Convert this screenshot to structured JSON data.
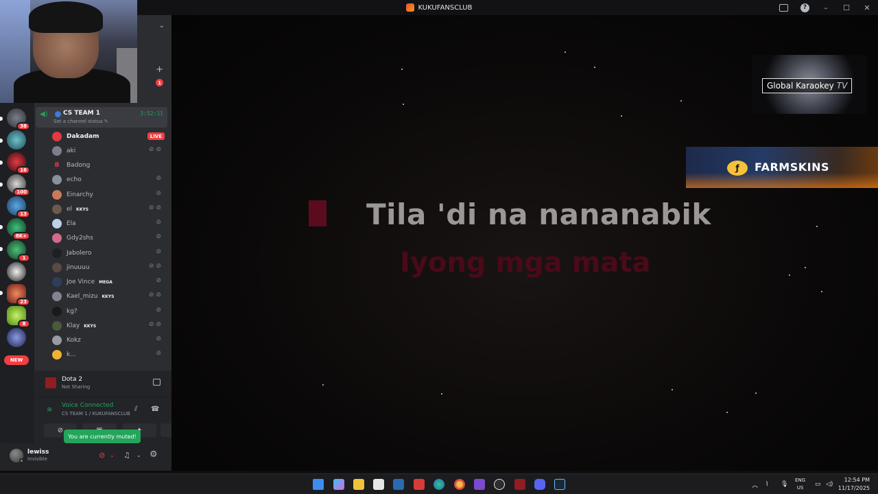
{
  "window": {
    "title": "KUKUFANSCLUB"
  },
  "servers": [
    {
      "badge": "38"
    },
    {
      "badge": ""
    },
    {
      "badge": "16"
    },
    {
      "badge": "100"
    },
    {
      "badge": "13"
    },
    {
      "badge": "8K+"
    },
    {
      "badge": "1"
    },
    {
      "badge": ""
    },
    {
      "badge": "23"
    },
    {
      "badge": "8"
    },
    {
      "badge": ""
    }
  ],
  "new_badge": "NEW",
  "mention_count": "1",
  "voice_channel": {
    "name": "CS TEAM 1",
    "timer": "3:52:11",
    "status_prompt": "Set a channel status"
  },
  "members": [
    {
      "name": "Dakadam",
      "live": "LIVE"
    },
    {
      "name": "aki"
    },
    {
      "name": "Badong"
    },
    {
      "name": "echo"
    },
    {
      "name": "Einarchy"
    },
    {
      "name": "el",
      "tag": "KKYS"
    },
    {
      "name": "Ela"
    },
    {
      "name": "Gdy2shs"
    },
    {
      "name": "Jabolero"
    },
    {
      "name": "jinuuuu"
    },
    {
      "name": "Joe Vince",
      "tag": "MEGA"
    },
    {
      "name": "Kael_mizu",
      "tag": "KKYS"
    },
    {
      "name": "kg?"
    },
    {
      "name": "Klay",
      "tag": "KKYS"
    },
    {
      "name": "Kokz"
    },
    {
      "name": "k..."
    }
  ],
  "activity": {
    "game": "Dota 2",
    "sharing": "Not Sharing"
  },
  "voice": {
    "status": "Voice Connected",
    "location": "CS TEAM 1 / KUKUFANSCLUB",
    "muted_tooltip": "You are currently muted!"
  },
  "user": {
    "name": "lewiss",
    "status": "Invisible"
  },
  "stage": {
    "lyric_line1": "Tila 'di na nananabik",
    "lyric_line2": "Iyong mga mata",
    "channel_logo_main": "Global Karaokey",
    "channel_logo_tv": "TV",
    "sponsor": "FARMSKINS"
  },
  "taskbar": {
    "lang_top": "ENG",
    "lang_bottom": "US",
    "time": "12:54 PM",
    "date": "11/17/2025"
  },
  "colors": {
    "accent_green": "#23a55a",
    "live_red": "#f23f42",
    "lyric_grey": "#9b9795",
    "lyric_red": "#4a0a18"
  }
}
